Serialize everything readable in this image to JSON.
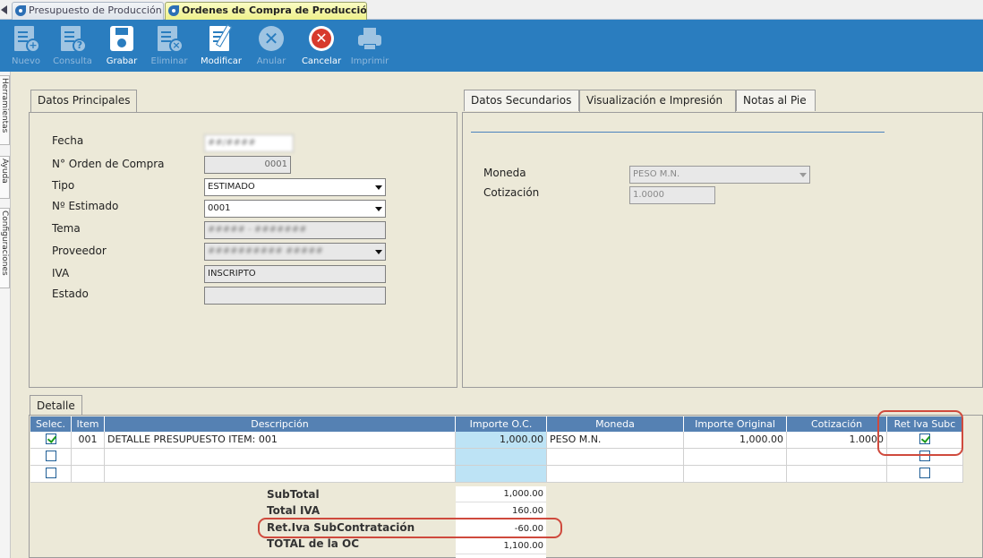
{
  "doc_tabs": [
    {
      "label": "Presupuesto de Producción"
    },
    {
      "label": "Ordenes de Compra de Producción"
    }
  ],
  "toolbar": [
    {
      "label": "Nuevo",
      "icon": "new-doc-icon",
      "enabled": false
    },
    {
      "label": "Consulta",
      "icon": "query-doc-icon",
      "enabled": false
    },
    {
      "label": "Grabar",
      "icon": "save-icon",
      "enabled": true
    },
    {
      "label": "Eliminar",
      "icon": "delete-doc-icon",
      "enabled": false
    },
    {
      "label": "Modificar",
      "icon": "edit-doc-icon",
      "enabled": true
    },
    {
      "label": "Anular",
      "icon": "void-icon",
      "enabled": false
    },
    {
      "label": "Cancelar",
      "icon": "cancel-icon",
      "enabled": true
    },
    {
      "label": "Imprimir",
      "icon": "print-icon",
      "enabled": false
    }
  ],
  "side_tabs": [
    "Herramientas",
    "Ayuda",
    "Configuraciones"
  ],
  "main_panel": {
    "tab": "Datos Principales",
    "fields": {
      "fecha": {
        "label": "Fecha",
        "value": "##/####"
      },
      "orden": {
        "label": "N° Orden de Compra",
        "value": "0001"
      },
      "tipo": {
        "label": "Tipo",
        "value": "ESTIMADO"
      },
      "estimado": {
        "label": "Nº Estimado",
        "value": "0001"
      },
      "tema": {
        "label": "Tema",
        "value": "##### - #######"
      },
      "proveedor": {
        "label": "Proveedor",
        "value": "########## #####"
      },
      "iva": {
        "label": "IVA",
        "value": "INSCRIPTO"
      },
      "estado": {
        "label": "Estado",
        "value": ""
      }
    }
  },
  "secondary_panel": {
    "tabs": [
      "Datos Secundarios",
      "Visualización e Impresión",
      "Notas al Pie"
    ],
    "moneda": {
      "label": "Moneda",
      "value": "PESO M.N."
    },
    "cotizacion": {
      "label": "Cotización",
      "value": "1.0000"
    }
  },
  "detail": {
    "tab": "Detalle",
    "columns": [
      "Selec.",
      "Item",
      "Descripción",
      "Importe O.C.",
      "Moneda",
      "Importe Original",
      "Cotización",
      "Ret Iva Subc"
    ],
    "rows": [
      {
        "selected": true,
        "item": "001",
        "descripcion": "DETALLE PRESUPUESTO ITEM: 001",
        "importe_oc": "1,000.00",
        "moneda": "PESO M.N.",
        "importe_original": "1,000.00",
        "cotizacion": "1.0000",
        "ret_iva_subc": true
      },
      {
        "selected": false,
        "item": "",
        "descripcion": "",
        "importe_oc": "",
        "moneda": "",
        "importe_original": "",
        "cotizacion": "",
        "ret_iva_subc": false
      },
      {
        "selected": false,
        "item": "",
        "descripcion": "",
        "importe_oc": "",
        "moneda": "",
        "importe_original": "",
        "cotizacion": "",
        "ret_iva_subc": false
      }
    ],
    "totals": [
      {
        "label": "SubTotal",
        "value": "1,000.00"
      },
      {
        "label": "Total IVA",
        "value": "160.00"
      },
      {
        "label": "Ret.Iva SubContratación",
        "value": "-60.00"
      },
      {
        "label": "TOTAL de la OC",
        "value": "1,100.00"
      }
    ]
  },
  "colors": {
    "toolbar_bg": "#2a7dbf",
    "grid_header": "#5581b3",
    "highlight": "#cf4a3d",
    "importe_cell": "#bde3f5"
  }
}
